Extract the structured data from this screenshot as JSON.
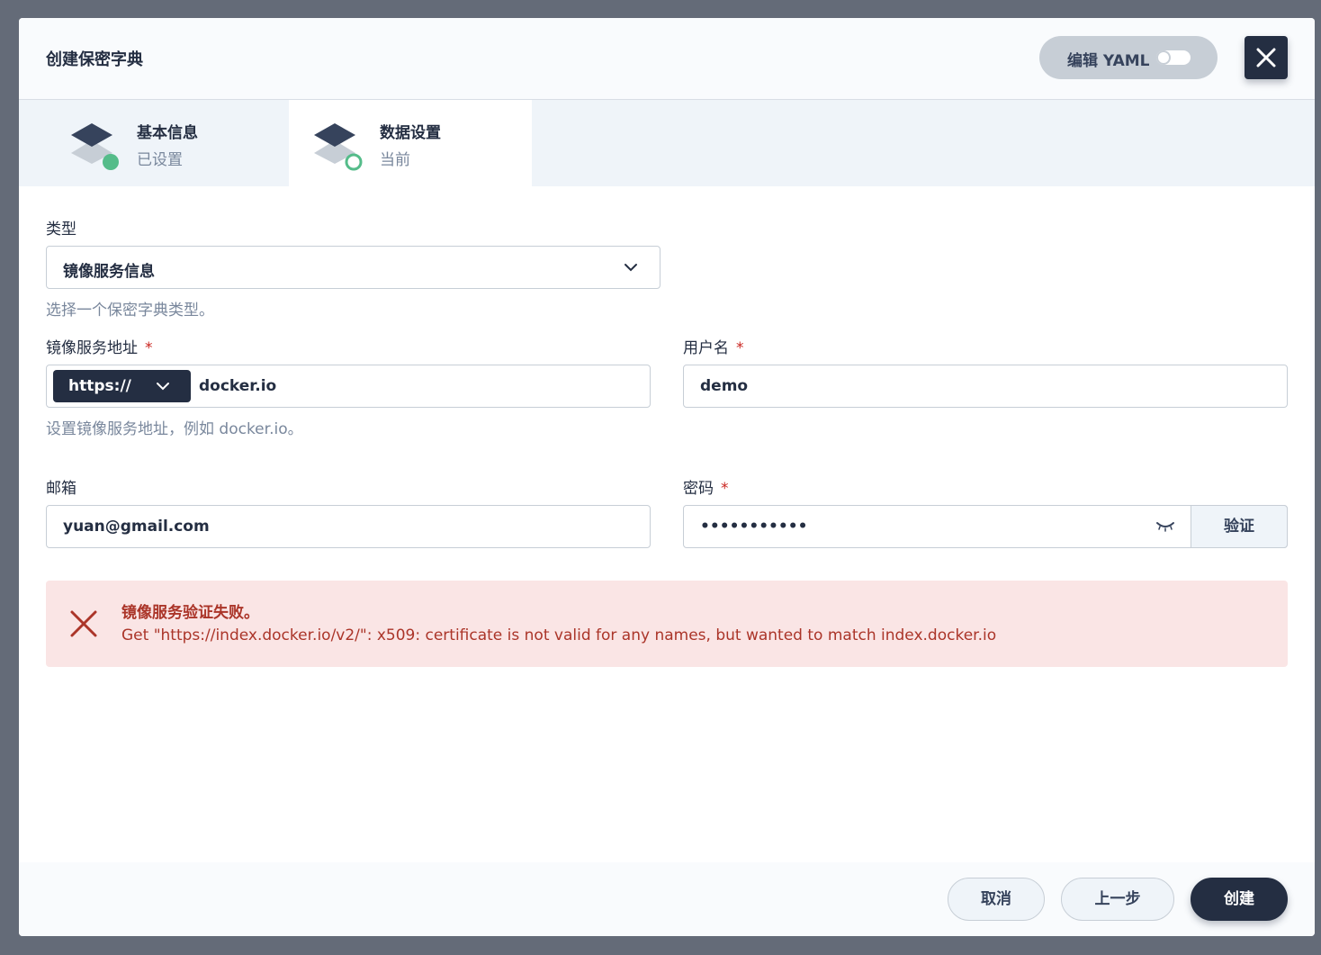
{
  "dialog": {
    "title": "创建保密字典",
    "edit_yaml_label": "编辑 YAML",
    "edit_yaml_enabled": false
  },
  "steps": [
    {
      "title": "基本信息",
      "status": "已设置",
      "state": "done"
    },
    {
      "title": "数据设置",
      "status": "当前",
      "state": "current"
    }
  ],
  "form": {
    "type": {
      "label": "类型",
      "value": "镜像服务信息",
      "hint": "选择一个保密字典类型。"
    },
    "registry": {
      "label": "镜像服务地址",
      "required_mark": "*",
      "protocol": "https://",
      "value": "docker.io",
      "hint": "设置镜像服务地址，例如 docker.io。"
    },
    "username": {
      "label": "用户名",
      "required_mark": "*",
      "value": "demo"
    },
    "email": {
      "label": "邮箱",
      "value": "yuan@gmail.com"
    },
    "password": {
      "label": "密码",
      "required_mark": "*",
      "masked_value": "•••••••••••",
      "verify_label": "验证"
    }
  },
  "alert": {
    "title": "镜像服务验证失败。",
    "message": "Get \"https://index.docker.io/v2/\": x509: certificate is not valid for any names, but wanted to match index.docker.io"
  },
  "footer": {
    "cancel_label": "取消",
    "prev_label": "上一步",
    "create_label": "创建"
  },
  "colors": {
    "primary": "#242e42",
    "success": "#55bc8a",
    "error_bg": "#fae5e5",
    "error_text": "#ab3529",
    "required": "#ca2621"
  }
}
